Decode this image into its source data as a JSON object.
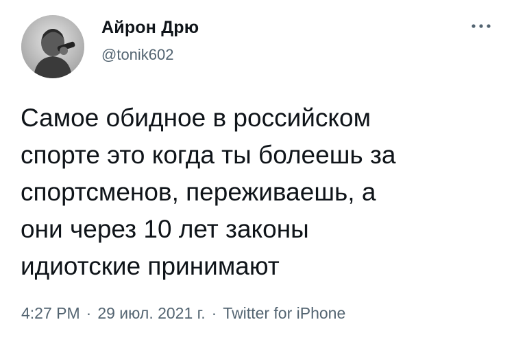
{
  "author": {
    "name": "Айрон Дрю",
    "handle": "@tonik602"
  },
  "tweet": {
    "lines": [
      "Самое обидное в российском",
      "спорте это когда ты болеешь за",
      "спортсменов, переживаешь, а",
      "они через 10 лет законы",
      "идиотские принимают"
    ]
  },
  "meta": {
    "time": "4:27 PM",
    "separator": "·",
    "date": "29 июл. 2021 г.",
    "source": "Twitter for iPhone"
  },
  "icons": {
    "more": "more-horizontal-icon",
    "avatar": "avatar-photo"
  },
  "colors": {
    "text": "#0f1419",
    "secondary": "#536471",
    "background": "#ffffff"
  }
}
